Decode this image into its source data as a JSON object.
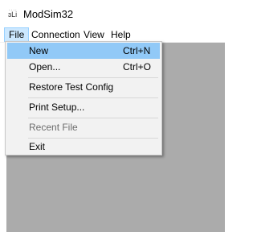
{
  "window": {
    "title": "ModSim32",
    "icon": "modsim-app-icon"
  },
  "menubar": {
    "items": [
      {
        "label": "File"
      },
      {
        "label": "Connection"
      },
      {
        "label": "View"
      },
      {
        "label": "Help"
      }
    ]
  },
  "file_menu": {
    "items": [
      {
        "label": "New",
        "shortcut": "Ctrl+N",
        "state": "highlighted"
      },
      {
        "label": "Open...",
        "shortcut": "Ctrl+O"
      },
      {
        "label": "Restore Test Config"
      },
      {
        "label": "Print Setup..."
      },
      {
        "label": "Recent File",
        "state": "disabled"
      },
      {
        "label": "Exit"
      }
    ]
  },
  "colors": {
    "highlight": "#91c9f7",
    "active_menu": "#cce8ff",
    "client_area": "#ababab",
    "menu_background": "#f2f2f2"
  }
}
